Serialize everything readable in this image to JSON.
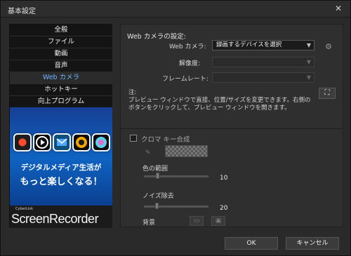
{
  "window": {
    "title": "基本設定",
    "close_icon": "close-icon"
  },
  "nav": {
    "items": [
      {
        "label": "全般",
        "active": false
      },
      {
        "label": "ファイル",
        "active": false
      },
      {
        "label": "動画",
        "active": false
      },
      {
        "label": "音声",
        "active": false
      },
      {
        "label": "Web カメラ",
        "active": true
      },
      {
        "label": "ホットキー",
        "active": false
      },
      {
        "label": "向上プログラム",
        "active": false
      }
    ]
  },
  "promo": {
    "line1": "デジタルメディア生活が",
    "line2": "もっと楽しくなる！",
    "icons": [
      "powerdirector-icon",
      "play-icon",
      "envelope-icon",
      "target-icon",
      "camera-icon"
    ],
    "brand": "CyberLink",
    "product": "ScreenRecorder"
  },
  "webcam": {
    "section_title": "Web カメラの設定:",
    "camera_label": "Web カメラ:",
    "camera_value": "録画するデバイスを選択",
    "resolution_label": "解像度:",
    "resolution_value": "",
    "framerate_label": "フレームレート:",
    "framerate_value": "",
    "note_title": "注:",
    "note_text": "プレビュー ウィンドウで直接、位置/サイズを変更できます。右側のボタンをクリックして、プレビュー ウィンドウを開きます。",
    "preview_icon": "expand-icon",
    "settings_icon": "gear-icon"
  },
  "chroma": {
    "label": "クロマ キー合成",
    "checked": false,
    "color_range_label": "色の範囲",
    "color_range_value": "10",
    "noise_label": "ノイズ除去",
    "noise_value": "20",
    "background_label": "背景"
  },
  "footer": {
    "ok_label": "OK",
    "cancel_label": "キャンセル"
  }
}
